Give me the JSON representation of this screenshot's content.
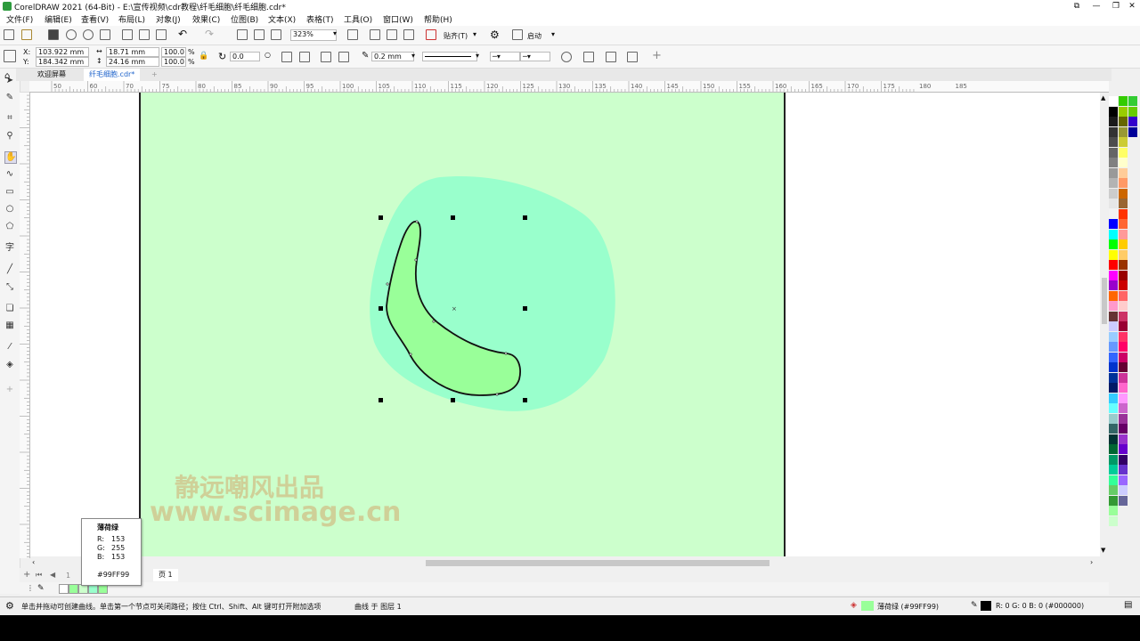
{
  "window": {
    "title": "CorelDRAW 2021 (64-Bit) - E:\\宣传视频\\cdr教程\\纤毛细胞\\纤毛细胞.cdr*",
    "controls": [
      "⧉",
      "—",
      "❐",
      "✕"
    ]
  },
  "menu": [
    "文件(F)",
    "编辑(E)",
    "查看(V)",
    "布局(L)",
    "对象(J)",
    "效果(C)",
    "位图(B)",
    "文本(X)",
    "表格(T)",
    "工具(O)",
    "窗口(W)",
    "帮助(H)"
  ],
  "toolbar": {
    "zoom": "323%",
    "snap_label": "贴齐(T)",
    "launch_label": "启动"
  },
  "propbar": {
    "x_label": "X:",
    "x_value": "103.922 mm",
    "y_label": "Y:",
    "y_value": "184.342 mm",
    "width": "18.71 mm",
    "height": "24.16 mm",
    "scale_w": "100.0",
    "scale_h": "100.0",
    "pct": "%",
    "rotation": "0.0",
    "outline_width": "0.2 mm"
  },
  "tabs": [
    "欢迎屏幕",
    "纤毛细胞.cdr*"
  ],
  "ruler_top_labels": [
    "50",
    "60",
    "70",
    "75",
    "80",
    "85",
    "90",
    "95",
    "100",
    "105",
    "110",
    "115",
    "120",
    "125",
    "130",
    "135",
    "140",
    "145",
    "150",
    "155",
    "160",
    "165",
    "170",
    "175",
    "180",
    "185"
  ],
  "watermark": {
    "line1": "静远嘲风出品",
    "line2": "www.scimage.cn"
  },
  "tooltip": {
    "name": "薄荷绿",
    "r_label": "R:",
    "r": "153",
    "g_label": "G:",
    "g": "255",
    "b_label": "B:",
    "b": "153",
    "hex": "#99FF99"
  },
  "pagebar": {
    "page_num": "1",
    "page_tab": "页 1"
  },
  "status": {
    "hint": "单击并拖动可创建曲线。单击第一个节点可关闭路径；按住 Ctrl、Shift、Alt 键可打开附加选项",
    "object": "曲线 于 图层 1",
    "fill_name": "薄荷绿 (#99FF99)",
    "outline": "R: 0 G: 0 B: 0 (#000000)"
  },
  "colors": {
    "page": "#ccffcc",
    "blob": "#99ffcc",
    "cell": "#99ff99",
    "accent": "#3399cc"
  },
  "icons": [
    "pick-tool-icon",
    "freehand-tool-icon",
    "crop-tool-icon",
    "zoom-tool-icon",
    "pan-tool-icon",
    "curve-tool-icon",
    "rectangle-tool-icon",
    "ellipse-tool-icon",
    "polygon-tool-icon",
    "text-tool-icon",
    "line-tool-icon",
    "connector-tool-icon",
    "shadow-tool-icon",
    "transparency-tool-icon",
    "eyedropper-tool-icon",
    "fill-tool-icon"
  ]
}
